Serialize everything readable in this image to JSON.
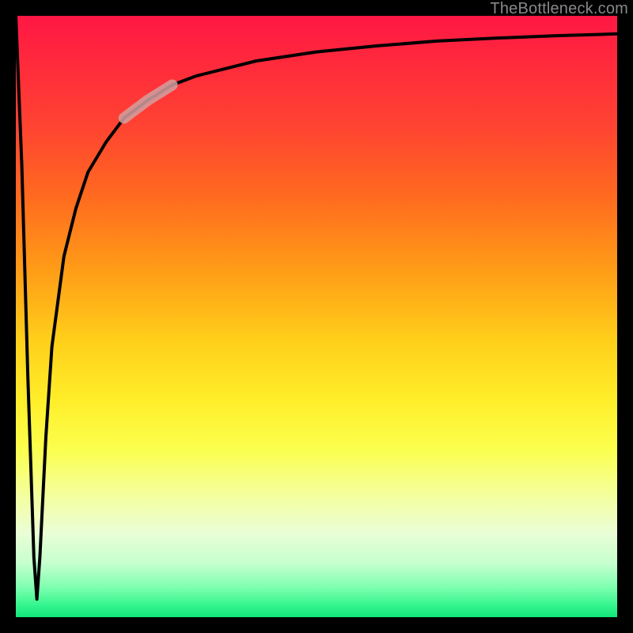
{
  "watermark": "TheBottleneck.com",
  "chart_data": {
    "type": "line",
    "title": "",
    "xlabel": "",
    "ylabel": "",
    "xlim": [
      0,
      100
    ],
    "ylim": [
      0,
      100
    ],
    "x": [
      0,
      1,
      2,
      3,
      3.5,
      4,
      5,
      6,
      8,
      10,
      12,
      15,
      18,
      22,
      26,
      30,
      40,
      50,
      60,
      70,
      80,
      90,
      100
    ],
    "values": [
      100,
      75,
      40,
      10,
      3,
      10,
      30,
      45,
      60,
      68,
      74,
      79,
      83,
      86,
      88.5,
      90,
      92.5,
      94,
      95,
      95.8,
      96.3,
      96.7,
      97
    ],
    "highlight_segment": {
      "x_start": 18,
      "x_end": 26
    },
    "gradient_stops": [
      {
        "pos": 0,
        "color": "#ff1744"
      },
      {
        "pos": 18,
        "color": "#ff4232"
      },
      {
        "pos": 42,
        "color": "#ff9b17"
      },
      {
        "pos": 64,
        "color": "#ffee2a"
      },
      {
        "pos": 86,
        "color": "#eafed6"
      },
      {
        "pos": 100,
        "color": "#10e57a"
      }
    ]
  }
}
